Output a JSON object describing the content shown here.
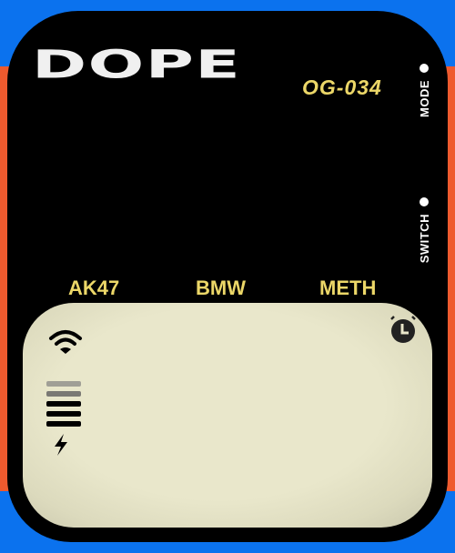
{
  "device": {
    "brand": "DOPE",
    "model": "OG-034",
    "side_buttons": [
      {
        "label": "MODE"
      },
      {
        "label": "SWITCH"
      }
    ],
    "modes": [
      {
        "label": "AK47"
      },
      {
        "label": "BMW"
      },
      {
        "label": "METH"
      }
    ]
  },
  "screen": {
    "icons": [
      "wifi-icon",
      "alarm-clock-icon",
      "battery-icon",
      "lightning-bolt-icon"
    ],
    "battery_level_bars": 3,
    "battery_total_bars": 5
  },
  "colors": {
    "background_blue": "#0b72ee",
    "background_orange": "#ee5a2e",
    "accent_yellow": "#ecd768",
    "screen": "#e9e7cb"
  }
}
